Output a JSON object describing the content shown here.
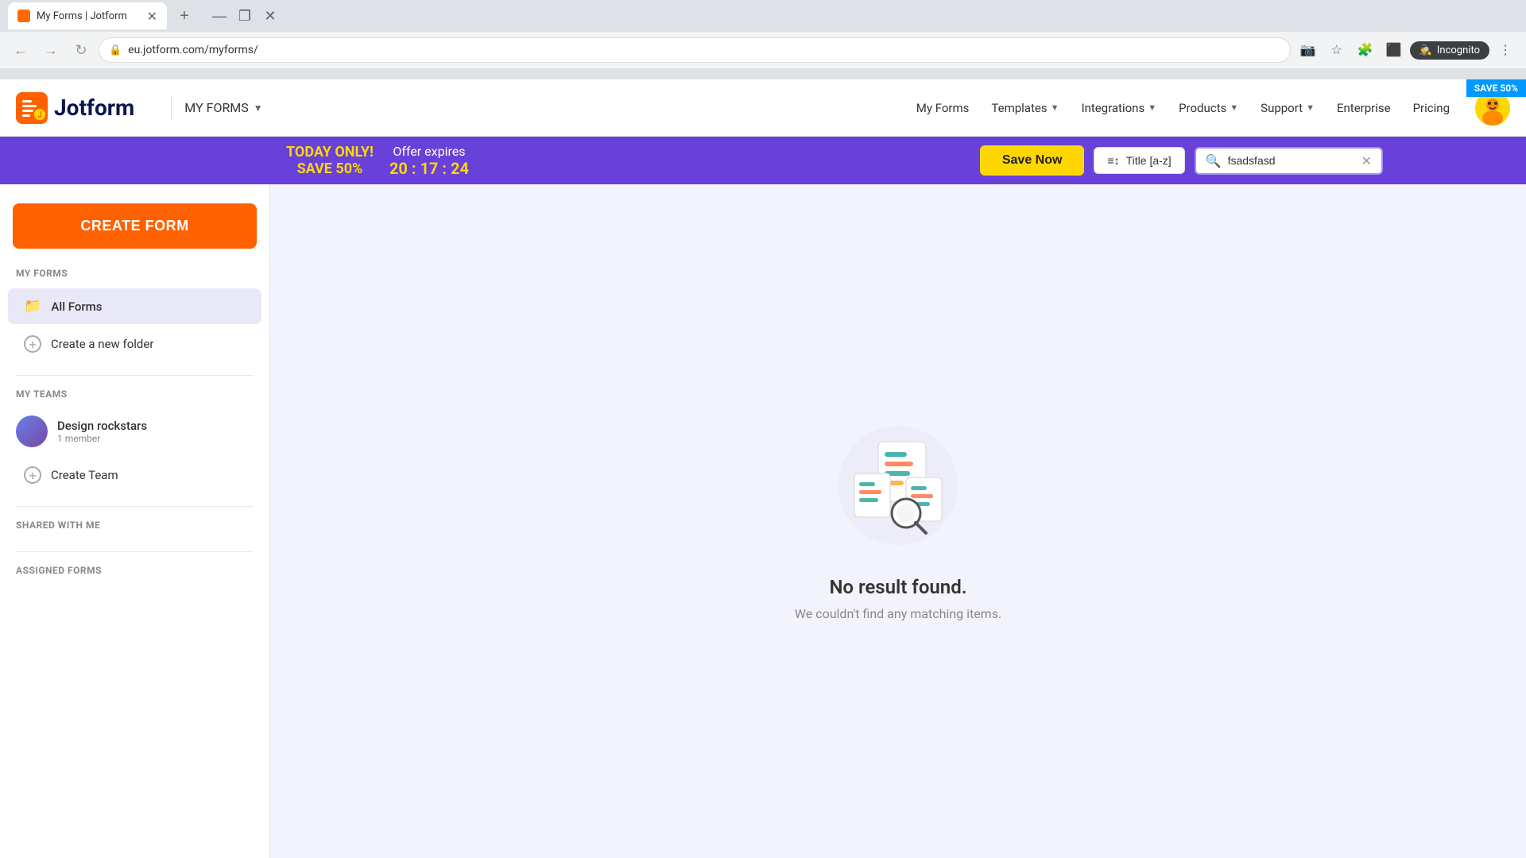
{
  "browser": {
    "tab_title": "My Forms | Jotform",
    "url": "eu.jotform.com/myforms/",
    "incognito_label": "Incognito"
  },
  "top_nav": {
    "logo_text": "Jotform",
    "save_badge": "SAVE 50%",
    "my_forms_label": "My Forms",
    "nav_items": [
      {
        "label": "My Forms",
        "has_dropdown": false
      },
      {
        "label": "Templates",
        "has_dropdown": true
      },
      {
        "label": "Integrations",
        "has_dropdown": true
      },
      {
        "label": "Products",
        "has_dropdown": true
      },
      {
        "label": "Support",
        "has_dropdown": true
      },
      {
        "label": "Enterprise",
        "has_dropdown": false
      },
      {
        "label": "Pricing",
        "has_dropdown": false
      }
    ]
  },
  "promo_banner": {
    "today_line1": "TODAY ONLY!",
    "today_line2": "SAVE 50%",
    "offer_label": "Offer expires",
    "timer": "20 : 17 : 24",
    "save_btn": "Save Now",
    "sort_label": "Title [a-z]",
    "search_value": "fsadsfasd"
  },
  "sidebar": {
    "create_form_label": "CREATE FORM",
    "my_forms_section": "MY FORMS",
    "all_forms_label": "All Forms",
    "create_folder_label": "Create a new folder",
    "my_teams_section": "MY TEAMS",
    "team_name": "Design rockstars",
    "team_members": "1 member",
    "create_team_label": "Create Team",
    "shared_section": "SHARED WITH ME",
    "assigned_section": "ASSIGNED FORMS"
  },
  "empty_state": {
    "title": "No result found.",
    "subtitle": "We couldn't find any matching items."
  }
}
